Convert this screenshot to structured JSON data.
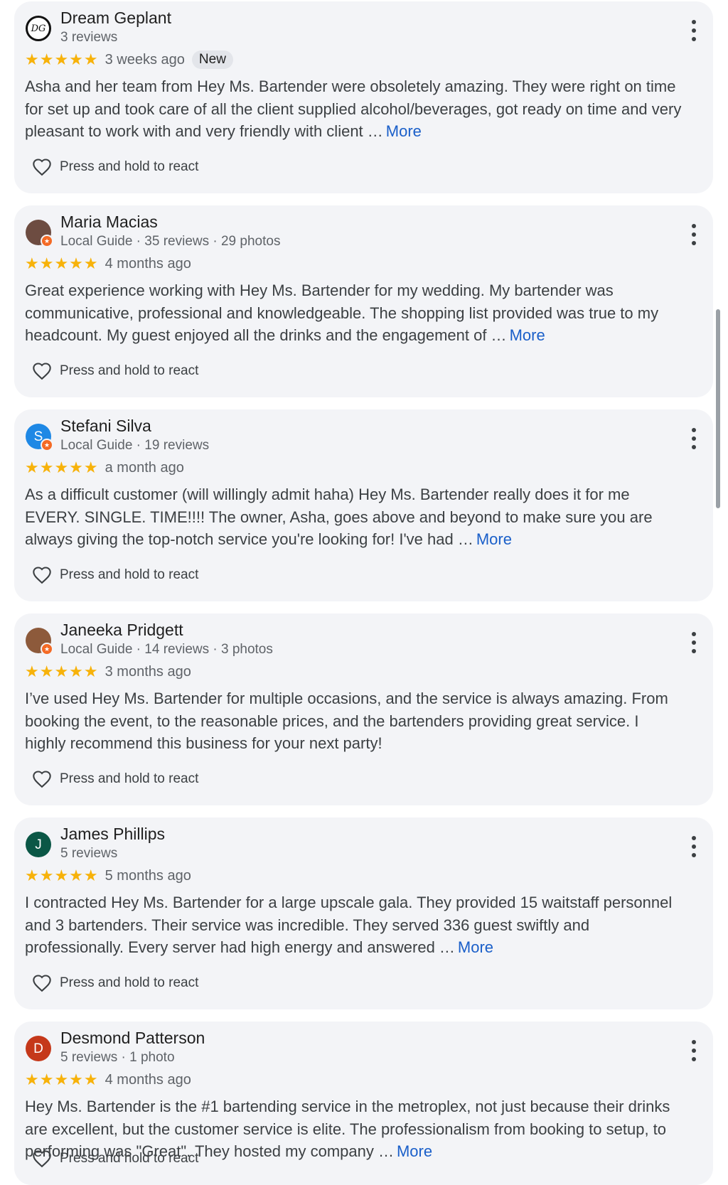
{
  "colors": {
    "star": "#f7b20a",
    "link": "#1a5fc9",
    "card_bg": "#f3f4f7"
  },
  "icons": {
    "star": "star-icon",
    "heart": "heart-icon",
    "menu": "more-vert-icon",
    "local_guide": "local-guide-badge-icon"
  },
  "more_label": "More",
  "react_label": "Press and hold to react",
  "reviews": [
    {
      "name": "Dream Geplant",
      "meta": "3 reviews",
      "stars": "★★★★★",
      "rating": 5,
      "time": "3 weeks ago",
      "badge": "New",
      "text": "Asha and her team from Hey Ms. Bartender were obsoletely amazing. They were right on time for set up and took care of all the client supplied alcohol/beverages, got ready on time and very pleasant to work with and very friendly with client …",
      "has_more": true,
      "avatar_text": "DG",
      "avatar_color": "#111111",
      "local_guide": false
    },
    {
      "name": "Maria Macias",
      "meta": "Local Guide · 35 reviews · 29 photos",
      "stars": "★★★★★",
      "rating": 5,
      "time": "4 months ago",
      "text": "Great experience working with Hey Ms. Bartender for my wedding. My bartender was communicative, professional and knowledgeable. The shopping list provided was true to my headcount. My guest enjoyed all the drinks and the engagement of …",
      "has_more": true,
      "avatar_text": "",
      "avatar_color": "#6d4c41",
      "local_guide": true
    },
    {
      "name": "Stefani Silva",
      "meta": "Local Guide · 19 reviews",
      "stars": "★★★★★",
      "rating": 5,
      "time": "a month ago",
      "text": "As a difficult customer (will willingly admit haha) Hey Ms. Bartender really does it for me EVERY. SINGLE. TIME!!!! The owner, Asha, goes above and beyond to make sure you are always giving the top-notch service you're looking for! I've had …",
      "has_more": true,
      "avatar_text": "S",
      "avatar_color": "#1e88e5",
      "local_guide": true
    },
    {
      "name": "Janeeka Pridgett",
      "meta": "Local Guide · 14 reviews · 3 photos",
      "stars": "★★★★★",
      "rating": 5,
      "time": "3 months ago",
      "text": "I’ve used Hey Ms. Bartender for multiple occasions, and the service is always amazing. From booking the event, to the reasonable prices, and the bartenders providing great service. I highly recommend this business for your next party!",
      "has_more": false,
      "avatar_text": "",
      "avatar_color": "#8d5a3b",
      "local_guide": true
    },
    {
      "name": "James Phillips",
      "meta": "5 reviews",
      "stars": "★★★★★",
      "rating": 5,
      "time": "5 months ago",
      "text": "I contracted Hey Ms. Bartender for a large upscale gala. They provided 15 waitstaff personnel and 3 bartenders. Their service was incredible. They served 336 guest swiftly and professionally. Every server had high energy and answered …",
      "has_more": true,
      "avatar_text": "J",
      "avatar_color": "#0b5746",
      "local_guide": false
    },
    {
      "name": "Desmond Patterson",
      "meta": "5 reviews · 1 photo",
      "stars": "★★★★★",
      "rating": 5,
      "time": "4 months ago",
      "text": "Hey Ms. Bartender is the #1 bartending service in the metroplex, not just because their drinks are excellent, but the customer service is elite. The professionalism from booking to setup, to performing was \"Great\". They hosted my company …",
      "has_more": true,
      "avatar_text": "D",
      "avatar_color": "#c5381a",
      "local_guide": false
    }
  ]
}
